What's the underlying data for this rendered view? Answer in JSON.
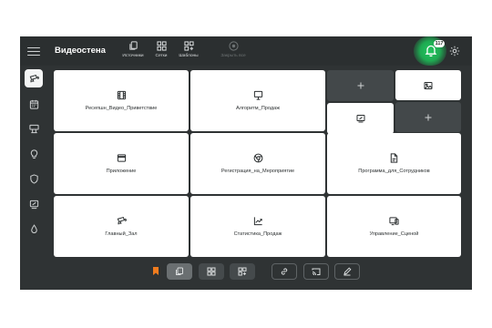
{
  "app": {
    "title": "Видеостена"
  },
  "toolbar": {
    "items": [
      {
        "label": "Источники",
        "icon": "copy-icon"
      },
      {
        "label": "Сетки",
        "icon": "grid-icon"
      },
      {
        "label": "Шаблоны",
        "icon": "template-grid-icon"
      },
      {
        "label": "Закрыть все",
        "icon": "close-circle-icon",
        "disabled": true
      }
    ]
  },
  "notifications": {
    "count": "117",
    "accent": "#1faa52"
  },
  "sidebar": {
    "items": [
      {
        "icon": "camera-icon",
        "active": true
      },
      {
        "icon": "calendar-icon"
      },
      {
        "icon": "billboard-icon"
      },
      {
        "icon": "lightbulb-icon"
      },
      {
        "icon": "shield-icon"
      },
      {
        "icon": "presentation-icon"
      },
      {
        "icon": "drop-icon"
      }
    ]
  },
  "grid": {
    "cells": [
      {
        "name": "Ресепшн_Видео_Приветствие",
        "icon": "film-icon"
      },
      {
        "name": "Алгоритм_Продаж",
        "icon": "presentation-icon"
      },
      {
        "name": "Приложение",
        "icon": "window-icon"
      },
      {
        "name": "Регистрация_на_Мероприятие",
        "icon": "chrome-icon"
      },
      {
        "name": "Программа_для_Сотрудников",
        "icon": "pdf-icon"
      },
      {
        "name": "Главный_Зал",
        "icon": "camera-icon"
      },
      {
        "name": "Статистика_Продаж",
        "icon": "chart-line-icon"
      },
      {
        "name": "Управление_Сценой",
        "icon": "monitor-icon"
      }
    ],
    "mini": [
      {
        "icon": "plus-icon"
      },
      {
        "icon": "image-icon"
      },
      {
        "icon": "presentation-icon"
      },
      {
        "icon": "plus-icon"
      }
    ]
  },
  "bottombar": {
    "buttons": [
      {
        "icon": "copy-icon",
        "active": true
      },
      {
        "icon": "grid-icon"
      },
      {
        "icon": "add-grid-icon"
      },
      {
        "icon": "link-icon"
      },
      {
        "icon": "cast-icon"
      },
      {
        "icon": "pen-icon"
      }
    ],
    "bookmark_color": "#f07c1e"
  }
}
